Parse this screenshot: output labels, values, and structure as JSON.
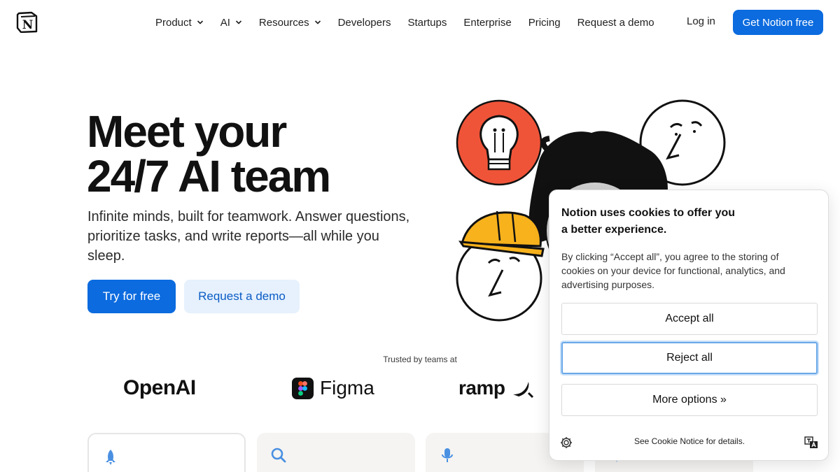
{
  "nav": {
    "logo": "notion-logo",
    "items": [
      {
        "label": "Product",
        "dropdown": true
      },
      {
        "label": "AI",
        "dropdown": true
      },
      {
        "label": "Resources",
        "dropdown": true
      },
      {
        "label": "Developers",
        "dropdown": false
      },
      {
        "label": "Startups",
        "dropdown": false
      },
      {
        "label": "Enterprise",
        "dropdown": false
      },
      {
        "label": "Pricing",
        "dropdown": false
      },
      {
        "label": "Request a demo",
        "dropdown": false
      }
    ],
    "login": "Log in",
    "cta": "Get Notion free"
  },
  "hero": {
    "title_line1": "Meet your",
    "title_line2": "24/7 AI team",
    "subtitle": "Infinite minds, built for teamwork. Answer questions, prioritize tasks, and write reports—all while you sleep.",
    "primary_button": "Try for free",
    "secondary_button": "Request a demo"
  },
  "trusted": {
    "label": "Trusted by teams at",
    "brands": [
      "OpenAI",
      "Figma",
      "ramp"
    ]
  },
  "cards": [
    {
      "icon": "rocket-icon"
    },
    {
      "icon": "search-icon"
    },
    {
      "icon": "microphone-icon"
    },
    {
      "icon": "sparkle-icon"
    }
  ],
  "cookie": {
    "title": "Notion uses cookies to offer you a better experience.",
    "body": "By clicking “Accept all”, you agree to the storing of cookies on your device for functional, analytics, and advertising purposes.",
    "accept": "Accept all",
    "reject": "Reject all",
    "more": "More options »",
    "footer": "See Cookie Notice for details."
  },
  "colors": {
    "accent": "#0b6bdf",
    "accent_light": "#e6f1fd"
  }
}
